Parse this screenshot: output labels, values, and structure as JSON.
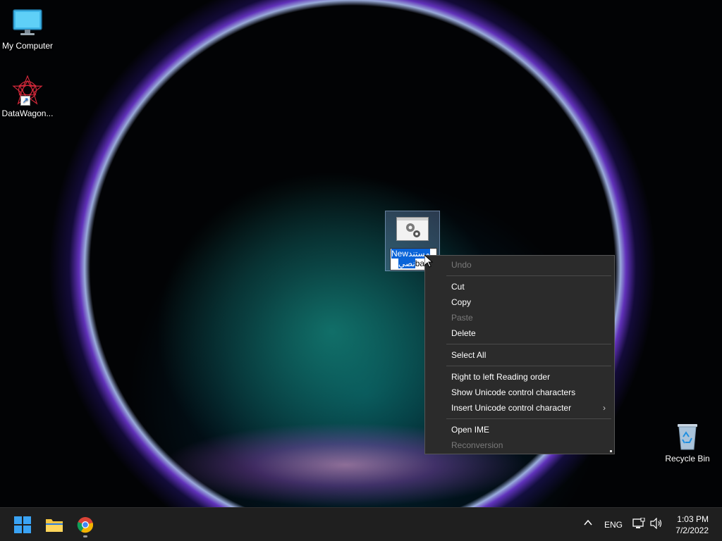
{
  "desktop": {
    "icons": [
      {
        "label": "My Computer"
      },
      {
        "label": "DataWagon..."
      },
      {
        "label": "Recycle Bin"
      }
    ],
    "rename_box": {
      "selected_line1_en": "New",
      "selected_line1_ar": "مستند",
      "line2_ar": "نصي",
      "line2_tail": "ba"
    }
  },
  "context_menu": {
    "items": [
      {
        "label": "Undo",
        "enabled": false
      },
      {
        "label": "Cut",
        "enabled": true
      },
      {
        "label": "Copy",
        "enabled": true
      },
      {
        "label": "Paste",
        "enabled": false
      },
      {
        "label": "Delete",
        "enabled": true
      },
      {
        "label": "Select All",
        "enabled": true
      },
      {
        "label": "Right to left Reading order",
        "enabled": true
      },
      {
        "label": "Show Unicode control characters",
        "enabled": true
      },
      {
        "label": "Insert Unicode control character",
        "enabled": true,
        "submenu_arrow": "›"
      },
      {
        "label": "Open IME",
        "enabled": true
      },
      {
        "label": "Reconversion",
        "enabled": false
      }
    ]
  },
  "taskbar": {
    "language": "ENG",
    "time": "1:03 PM",
    "date": "7/2/2022",
    "tray_chevron": "^"
  },
  "colors": {
    "selection": "#0a64d8",
    "menu_bg": "#2b2b2b",
    "taskbar_bg": "#1f1f1f"
  }
}
